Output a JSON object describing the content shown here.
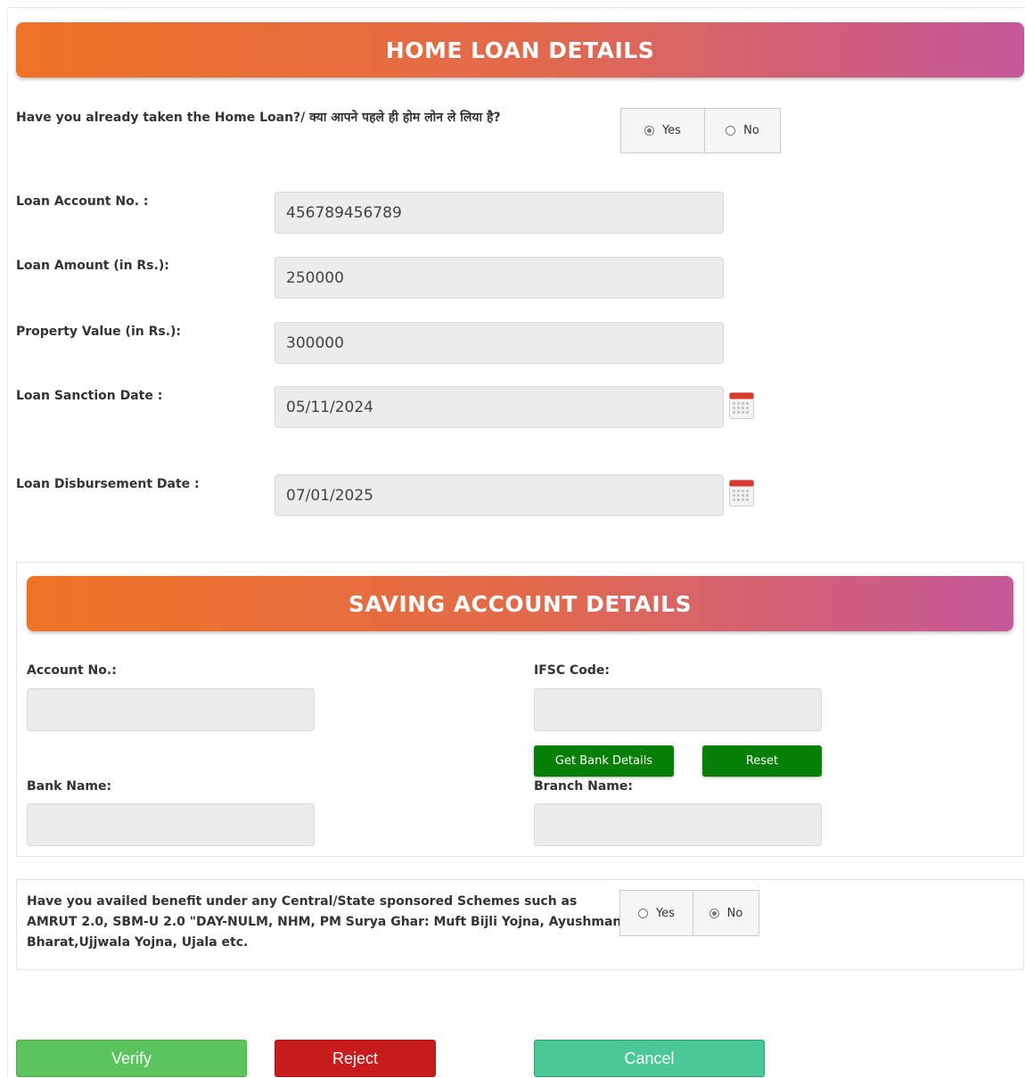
{
  "home_loan": {
    "title": "HOME LOAN DETAILS",
    "question": "Have you already taken the Home Loan?/ क्या आपने पहले ही होम लोन ले लिया है?",
    "radio": {
      "yes": "Yes",
      "no": "No",
      "selected": "Yes"
    },
    "fields": {
      "loan_account_label": "Loan Account No. :",
      "loan_account_value": "456789456789",
      "loan_amount_label": "Loan Amount (in Rs.):",
      "loan_amount_value": "250000",
      "property_value_label": "Property Value (in Rs.):",
      "property_value_value": "300000",
      "sanction_date_label": "Loan Sanction Date :",
      "sanction_date_value": "05/11/2024",
      "disbursement_date_label": "Loan Disbursement Date :",
      "disbursement_date_value": "07/01/2025"
    }
  },
  "saving_account": {
    "title": "SAVING ACCOUNT DETAILS",
    "account_no_label": "Account No.:",
    "account_no_value": "",
    "ifsc_label": "IFSC Code:",
    "ifsc_value": "",
    "get_bank_details": "Get Bank Details",
    "reset": "Reset",
    "bank_name_label": "Bank Name:",
    "bank_name_value": "",
    "branch_name_label": "Branch Name:",
    "branch_name_value": ""
  },
  "schemes": {
    "question_line1": "Have you availed benefit under any Central/State sponsored Schemes such as",
    "question_line2": "AMRUT 2.0, SBM-U 2.0 \"DAY-NULM, NHM, PM Surya Ghar: Muft Bijli Yojna, Ayushman",
    "question_line3": "Bharat,Ujjwala Yojna, Ujala etc.",
    "radio": {
      "yes": "Yes",
      "no": "No",
      "selected": "No"
    }
  },
  "actions": {
    "verify": "Verify",
    "reject": "Reject",
    "cancel": "Cancel"
  },
  "colors": {
    "banner_start": "#ee7326",
    "banner_end": "#c4589a",
    "green_button": "#057f05",
    "verify": "#5cc45c",
    "reject": "#c81b1b",
    "cancel": "#4ac996"
  }
}
